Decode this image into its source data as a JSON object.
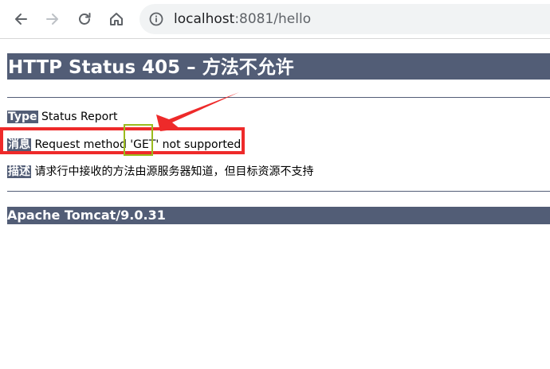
{
  "browser": {
    "url_host": "localhost",
    "url_rest": ":8081/hello",
    "icons": [
      "back-icon",
      "forward-icon",
      "reload-icon",
      "home-icon",
      "site-info-icon"
    ]
  },
  "page": {
    "title": "HTTP Status 405 – 方法不允许",
    "type_label": "Type",
    "type_value": "Status Report",
    "message_label": "消息",
    "message_value": "Request method 'GET' not supported",
    "description_label": "描述",
    "description_value": "请求行中接收的方法由源服务器知道，但目标资源不支持",
    "server": "Apache Tomcat/9.0.31"
  },
  "annotations": {
    "highlight_color": "#ee2a2a",
    "marker_color": "#9bbb1e"
  },
  "colors": {
    "header_bg": "#525d76",
    "toolbar_bg": "#ffffff",
    "omnibox_bg": "#f1f3f4"
  }
}
